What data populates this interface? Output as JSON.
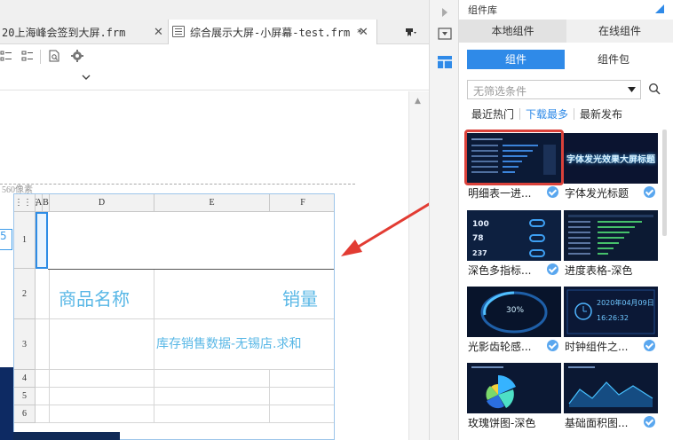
{
  "tabs": [
    {
      "label": "20上海峰会签到大屏.frm"
    },
    {
      "label": "综合展示大屏-小屏幕-test.frm *"
    }
  ],
  "canvas": {
    "width_label": "560像素",
    "side_tab": "5",
    "columns": [
      "",
      "A",
      "B",
      "D",
      "E",
      "F"
    ],
    "rows": [
      "1",
      "2",
      "3",
      "4",
      "5",
      "6"
    ],
    "product_name": "商品名称",
    "sales": "销量",
    "inventory_title": "库存销售数据-无锡店.求和"
  },
  "panel": {
    "title": "组件库",
    "main_tabs": [
      "本地组件",
      "在线组件"
    ],
    "sub_tabs": [
      "组件",
      "组件包"
    ],
    "filter_placeholder": "无筛选条件",
    "sort_tabs": [
      "最近热门",
      "下载最多",
      "最新发布"
    ],
    "cards": [
      {
        "label": "明细表一进...",
        "thumb_icon": "detail-table-thumbnail",
        "checked": true
      },
      {
        "label": "字体发光标题",
        "thumb_icon": "glow-title-thumbnail",
        "thumb_text": "字体发光效果大屏标题",
        "checked": true
      },
      {
        "label": "深色多指标...",
        "thumb_icon": "multi-indicator-thumbnail",
        "thumb_values": [
          "100",
          "78",
          "237"
        ],
        "checked": true
      },
      {
        "label": "进度表格-深色",
        "thumb_icon": "progress-table-thumbnail",
        "checked": false
      },
      {
        "label": "光影齿轮感...",
        "thumb_icon": "gear-ring-thumbnail",
        "thumb_value": "30%",
        "checked": true
      },
      {
        "label": "时钟组件之...",
        "thumb_icon": "clock-thumbnail",
        "thumb_date": "2020年04月09日",
        "thumb_time": "16:26:32",
        "checked": true
      },
      {
        "label": "玫瑰饼图-深色",
        "thumb_icon": "rose-pie-thumbnail",
        "checked": false
      },
      {
        "label": "基础面积图...",
        "thumb_icon": "area-chart-thumbnail",
        "checked": true
      }
    ]
  },
  "colors": {
    "accent": "#2f8ae8",
    "highlight_red": "#d9413a",
    "cell_text": "#58b7e6",
    "thumb_bg": "#0a1730"
  }
}
